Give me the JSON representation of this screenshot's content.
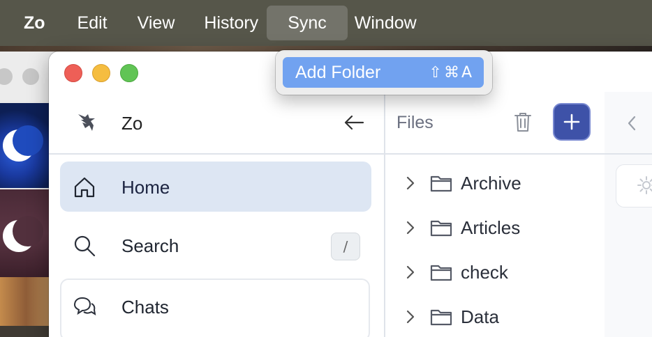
{
  "menubar": {
    "app": "Zo",
    "items": [
      "Edit",
      "View",
      "History",
      "Sync",
      "Window"
    ],
    "active": "Sync"
  },
  "dropdown": {
    "items": [
      {
        "label": "Add Folder",
        "shortcut": "⇧⌘A"
      }
    ]
  },
  "sidebar": {
    "app_name": "Zo",
    "nav": [
      {
        "label": "Home",
        "icon": "home-icon",
        "selected": true
      },
      {
        "label": "Search",
        "icon": "search-icon",
        "shortcut": "/"
      },
      {
        "label": "Chats",
        "icon": "chat-bubbles-icon"
      }
    ]
  },
  "files": {
    "title": "Files",
    "items": [
      "Archive",
      "Articles",
      "check",
      "Data"
    ]
  },
  "colors": {
    "accent": "#3e52a8",
    "selection": "#dde6f3",
    "menu_highlight": "#71a2f0"
  }
}
